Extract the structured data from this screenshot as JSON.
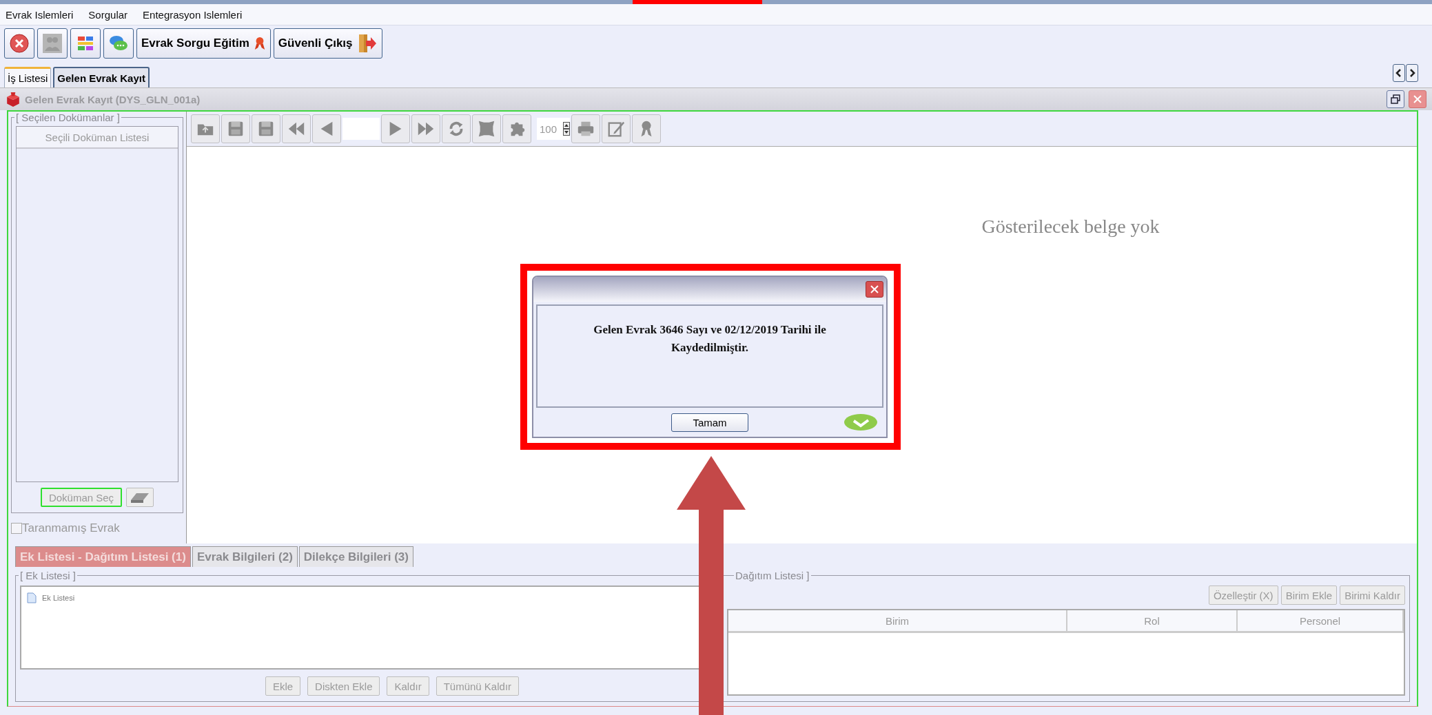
{
  "menu": [
    {
      "label": "Evrak Islemleri"
    },
    {
      "label": "Sorgular"
    },
    {
      "label": "Entegrasyon Islemleri"
    }
  ],
  "toolbar": [
    {
      "kind": "close"
    },
    {
      "kind": "people"
    },
    {
      "kind": "tiles"
    },
    {
      "kind": "chat"
    },
    {
      "kind": "training",
      "label": "Evrak Sorgu Eğitim"
    },
    {
      "kind": "exit",
      "label": "Güvenli Çıkış"
    }
  ],
  "tabs": [
    {
      "label": "İş Listesi",
      "selected": false
    },
    {
      "label": "Gelen Evrak Kayıt",
      "selected": true
    }
  ],
  "frame": {
    "title": "Gelen Evrak Kayıt (DYS_GLN_001a)"
  },
  "documents": {
    "legend": "[ Seçilen Dokümanlar ]",
    "list_header": "Seçili Doküman Listesi",
    "select_button": "Doküman Seç",
    "checkbox": {
      "label": "Taranmamış Evrak",
      "checked": false
    }
  },
  "viewer": {
    "tools": [
      {
        "kind": "open"
      },
      {
        "kind": "save"
      },
      {
        "kind": "save"
      },
      {
        "kind": "first"
      },
      {
        "kind": "prev"
      },
      {
        "kind": "page"
      },
      {
        "kind": "next"
      },
      {
        "kind": "last"
      },
      {
        "kind": "rotate"
      },
      {
        "kind": "fit"
      },
      {
        "kind": "puzzle"
      },
      {
        "kind": "zoom",
        "value": "100"
      },
      {
        "kind": "print"
      },
      {
        "kind": "edit"
      },
      {
        "kind": "award"
      }
    ],
    "message": "Gösterilecek belge yok"
  },
  "bottom_tabs": [
    {
      "label": "Ek Listesi - Dağıtım Listesi (1)",
      "selected": true
    },
    {
      "label": "Evrak Bilgileri (2)",
      "selected": false
    },
    {
      "label": "Dilekçe Bilgileri (3)",
      "selected": false
    }
  ],
  "attachments": {
    "legend": "[ Ek Listesi ]",
    "items": [
      {
        "label": "Ek Listesi"
      }
    ],
    "buttons": [
      {
        "label": "Ekle"
      },
      {
        "label": "Diskten Ekle"
      },
      {
        "label": "Kaldır"
      },
      {
        "label": "Tümünü Kaldır"
      }
    ]
  },
  "distribution": {
    "legend": "Dağıtım Listesi ]",
    "buttons": [
      {
        "label": "Özelleştir (X)"
      },
      {
        "label": "Birim Ekle"
      },
      {
        "label": "Birimi Kaldır"
      }
    ],
    "columns": [
      "Birim",
      "Rol",
      "Personel"
    ]
  },
  "dialog": {
    "message": "Gelen Evrak 3646 Sayı ve 02/12/2019 Tarihi ile Kaydedilmiştir.",
    "button": "Tamam"
  }
}
